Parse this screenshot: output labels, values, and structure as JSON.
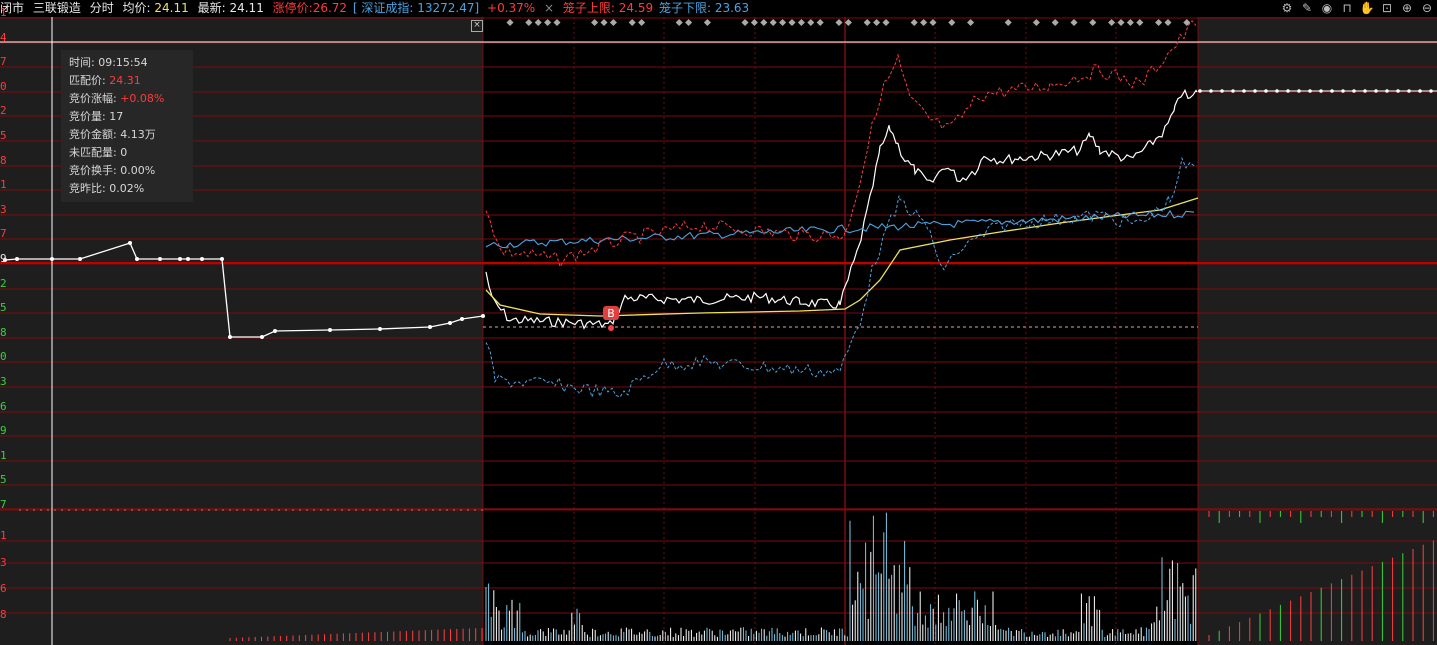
{
  "topbar": {
    "status": "闭市",
    "stock_name": "三联锻造",
    "period": "分时",
    "avg_label": "均价:",
    "avg_value": "24.11",
    "latest_label": "最新:",
    "latest_value": "24.11",
    "limit_up": "涨停价:26.72",
    "index_name": "[ 深证成指: 13272.47]",
    "index_change": "+0.37%",
    "close_mark": "×",
    "cage_upper": "笼子上限: 24.59",
    "cage_lower": "笼子下限: 23.63"
  },
  "toolbar": [
    "settings-icon",
    "pen-icon",
    "eye-icon",
    "basket-icon",
    "hand-icon",
    "lock-icon",
    "zoom-in-icon",
    "zoom-out-icon"
  ],
  "info_panel": {
    "time_label": "时间:",
    "time_value": "09:15:54",
    "match_price_label": "匹配价:",
    "match_price_value": "24.31",
    "auction_change_label": "竞价涨幅:",
    "auction_change_value": "+0.08%",
    "auction_volume_label": "竞价量:",
    "auction_volume_value": "17",
    "auction_amount_label": "竞价金额:",
    "auction_amount_value": "4.13万",
    "unmatched_label": "未匹配量:",
    "unmatched_value": "0",
    "turnover_label": "竞价换手:",
    "turnover_value": "0.00%",
    "prev_ratio_label": "竞昨比:",
    "prev_ratio_value": "0.02%"
  },
  "y_labels": [
    {
      "text": "1",
      "color": "#ff3b3b"
    },
    {
      "text": "4",
      "color": "#ff3b3b"
    },
    {
      "text": "7",
      "color": "#ff3b3b"
    },
    {
      "text": "0",
      "color": "#ff3b3b"
    },
    {
      "text": "2",
      "color": "#ff3b3b"
    },
    {
      "text": "5",
      "color": "#ff3b3b"
    },
    {
      "text": "8",
      "color": "#ff3b3b"
    },
    {
      "text": "1",
      "color": "#ff3b3b"
    },
    {
      "text": "3",
      "color": "#ff3b3b"
    },
    {
      "text": "7",
      "color": "#ff3b3b"
    },
    {
      "text": "9",
      "color": "#e8e8e8"
    },
    {
      "text": "2",
      "color": "#3bd13b"
    },
    {
      "text": "5",
      "color": "#3bd13b"
    },
    {
      "text": "8",
      "color": "#3bd13b"
    },
    {
      "text": "0",
      "color": "#3bd13b"
    },
    {
      "text": "3",
      "color": "#3bd13b"
    },
    {
      "text": "6",
      "color": "#3bd13b"
    },
    {
      "text": "9",
      "color": "#3bd13b"
    },
    {
      "text": "1",
      "color": "#3bd13b"
    },
    {
      "text": "5",
      "color": "#3bd13b"
    },
    {
      "text": "7",
      "color": "#3bd13b"
    }
  ],
  "vol_labels": [
    "1",
    "3",
    "6",
    "8"
  ],
  "marker_label": "B",
  "colors": {
    "grid": "#7a0d0d",
    "price": "#ffffff",
    "avg": "#f0e060",
    "index": "#4aa3e0",
    "limit": "#ff3b3b",
    "up": "#ff3b3b",
    "down": "#3bd13b"
  }
}
